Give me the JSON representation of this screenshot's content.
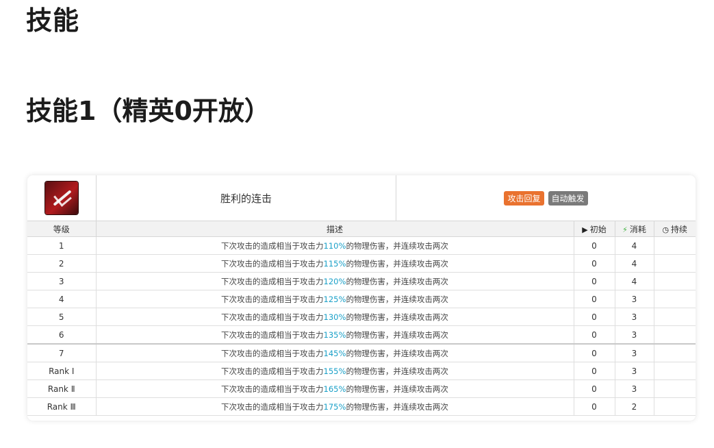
{
  "page": {
    "title": "技能",
    "subtitle": "技能1（精英0开放）"
  },
  "skill": {
    "name": "胜利的连击",
    "tags": [
      "攻击回复",
      "自动触发"
    ],
    "icon": "skill-icon"
  },
  "table": {
    "headers": {
      "level": "等级",
      "desc": "描述",
      "init": "初始",
      "cost": "消耗",
      "duration": "持续"
    },
    "desc_prefix": "下次攻击的造成相当于攻击力",
    "desc_suffix": "的物理伤害，并连续攻击两次",
    "rows": [
      {
        "level": "1",
        "pct": "110%",
        "init": "0",
        "cost": "4",
        "duration": ""
      },
      {
        "level": "2",
        "pct": "115%",
        "init": "0",
        "cost": "4",
        "duration": ""
      },
      {
        "level": "3",
        "pct": "120%",
        "init": "0",
        "cost": "4",
        "duration": ""
      },
      {
        "level": "4",
        "pct": "125%",
        "init": "0",
        "cost": "3",
        "duration": ""
      },
      {
        "level": "5",
        "pct": "130%",
        "init": "0",
        "cost": "3",
        "duration": ""
      },
      {
        "level": "6",
        "pct": "135%",
        "init": "0",
        "cost": "3",
        "duration": ""
      },
      {
        "level": "7",
        "pct": "145%",
        "init": "0",
        "cost": "3",
        "duration": ""
      },
      {
        "level": "Rank Ⅰ",
        "pct": "155%",
        "init": "0",
        "cost": "3",
        "duration": ""
      },
      {
        "level": "Rank Ⅱ",
        "pct": "165%",
        "init": "0",
        "cost": "3",
        "duration": ""
      },
      {
        "level": "Rank Ⅲ",
        "pct": "175%",
        "init": "0",
        "cost": "2",
        "duration": ""
      }
    ]
  },
  "colors": {
    "accent_pct": "#1aa0c8",
    "tag_orange": "#e9722f",
    "tag_gray": "#7a7a7a",
    "cost_icon": "#3fb13f"
  }
}
